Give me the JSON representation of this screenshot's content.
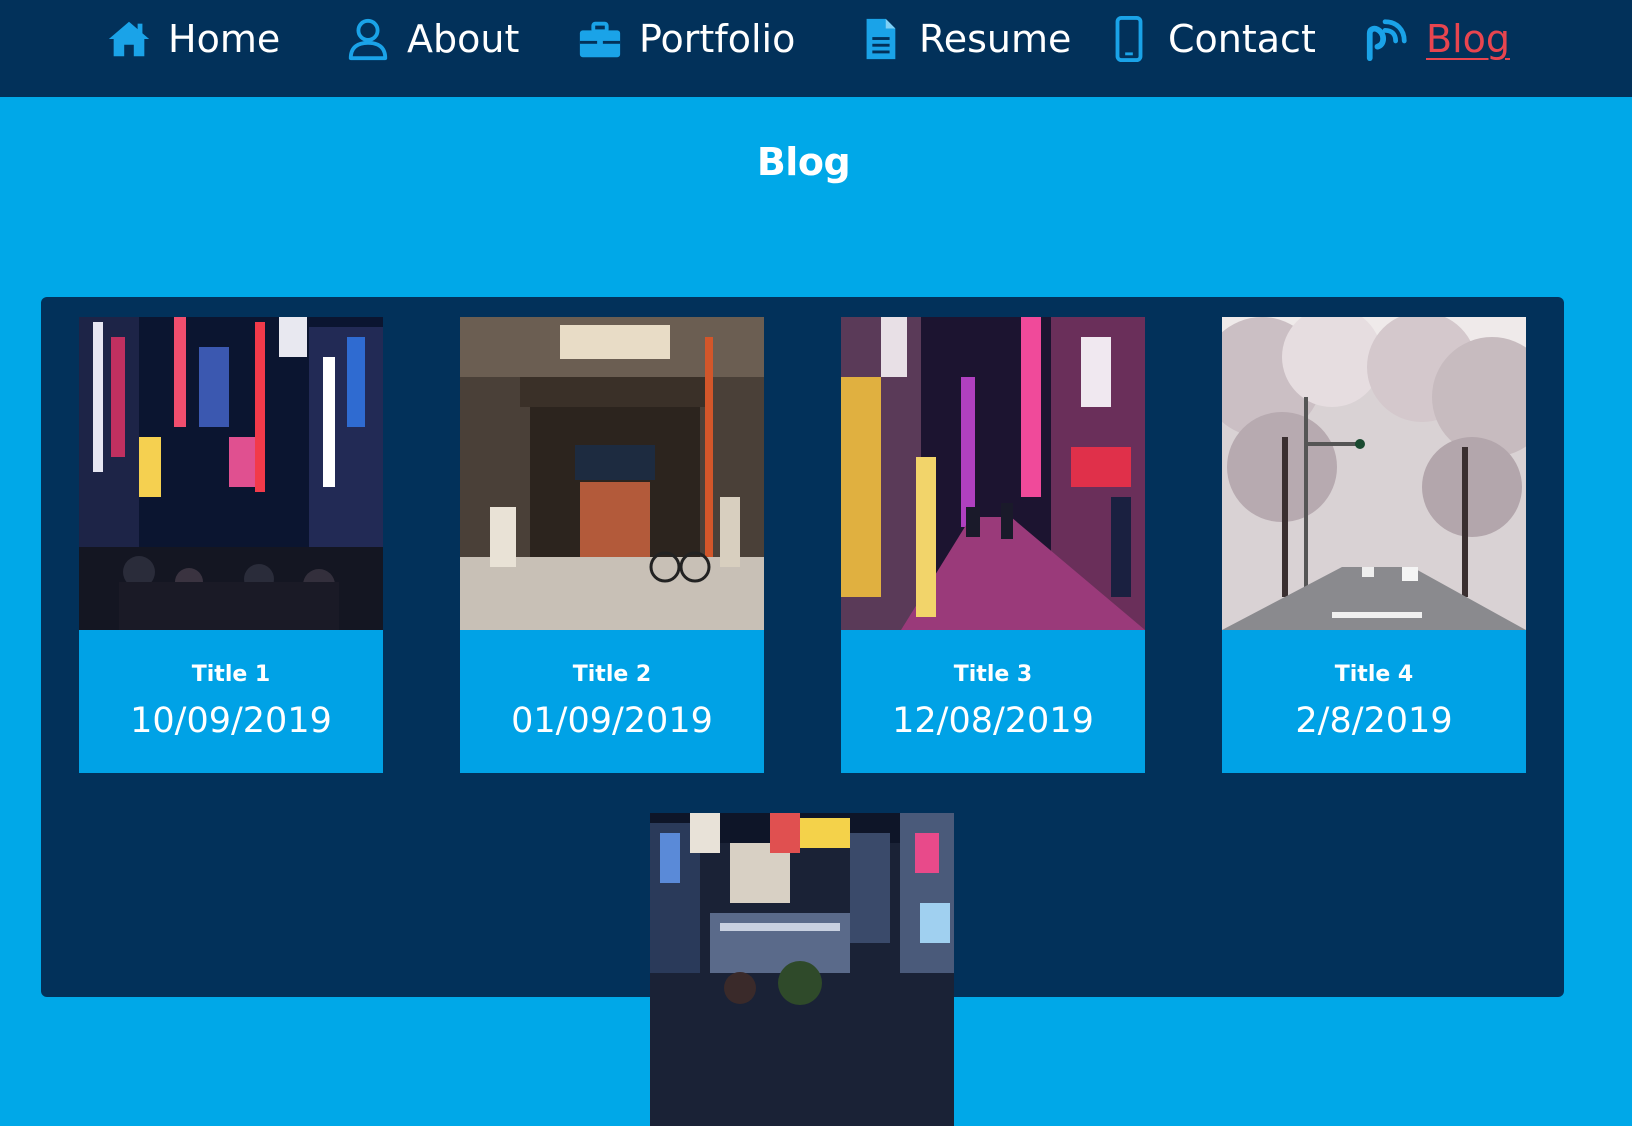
{
  "nav": {
    "items": [
      {
        "label": "Home",
        "icon": "home-icon"
      },
      {
        "label": "About",
        "icon": "user-icon"
      },
      {
        "label": "Portfolio",
        "icon": "briefcase-icon"
      },
      {
        "label": "Resume",
        "icon": "document-icon"
      },
      {
        "label": "Contact",
        "icon": "mobile-phone-icon"
      },
      {
        "label": "Blog",
        "icon": "rss-feed-icon",
        "active": true
      }
    ]
  },
  "page": {
    "title": "Blog"
  },
  "posts": [
    {
      "title": "Title 1",
      "date": "10/09/2019",
      "image": "neon-city-street-night-photo"
    },
    {
      "title": "Title 2",
      "date": "01/09/2019",
      "image": "japanese-shopfront-photo"
    },
    {
      "title": "Title 3",
      "date": "12/08/2019",
      "image": "pink-neon-alley-photo"
    },
    {
      "title": "Title 4",
      "date": "2/8/2019",
      "image": "cherry-blossom-street-photo"
    },
    {
      "image": "city-crossing-aerial-photo"
    }
  ],
  "colors": {
    "nav_background": "#02315a",
    "page_background": "#00a8e8",
    "panel_background": "#02315a",
    "icon_color": "#1aa3e8",
    "active_link": "#e8454f"
  }
}
